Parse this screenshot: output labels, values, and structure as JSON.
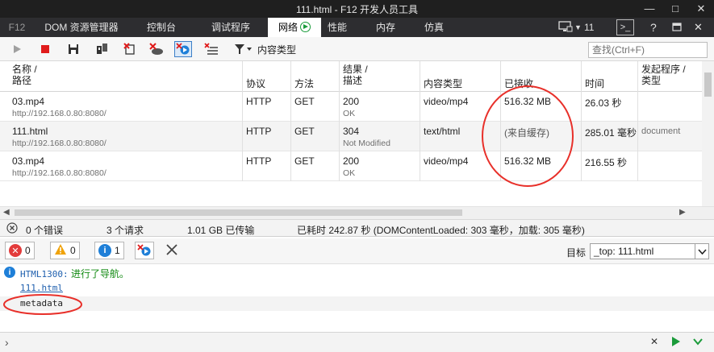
{
  "window": {
    "title": "111.html - F12 开发人员工具",
    "maximize_label": "□"
  },
  "tabs": [
    {
      "label": "F12"
    },
    {
      "label": "DOM 资源管理器"
    },
    {
      "label": "控制台"
    },
    {
      "label": "调试程序"
    },
    {
      "label": "网络"
    },
    {
      "label": "性能"
    },
    {
      "label": "内存"
    },
    {
      "label": "仿真"
    }
  ],
  "tab_right": {
    "count": "11"
  },
  "toolbar": {
    "filter_label": "内容类型",
    "search_placeholder": "查找(Ctrl+F)"
  },
  "grid": {
    "headers": {
      "name_line1": "名称 /",
      "name_line2": "路径",
      "protocol": "协议",
      "method": "方法",
      "result_line1": "结果 /",
      "result_line2": "描述",
      "type": "内容类型",
      "received": "已接收",
      "time": "时间",
      "initiator_line1": "发起程序 /",
      "initiator_line2": "类型"
    },
    "rows": [
      {
        "name": "03.mp4",
        "path": "http://192.168.0.80:8080/",
        "protocol": "HTTP",
        "method": "GET",
        "result": "200",
        "desc": "OK",
        "type": "video/mp4",
        "received": "516.32 MB",
        "time": "26.03 秒",
        "initiator": ""
      },
      {
        "name": "111.html",
        "path": "http://192.168.0.80:8080/",
        "protocol": "HTTP",
        "method": "GET",
        "result": "304",
        "desc": "Not Modified",
        "type": "text/html",
        "received": "(来自缓存)",
        "time": "285.01 毫秒",
        "initiator": "document"
      },
      {
        "name": "03.mp4",
        "path": "http://192.168.0.80:8080/",
        "protocol": "HTTP",
        "method": "GET",
        "result": "200",
        "desc": "OK",
        "type": "video/mp4",
        "received": "516.32 MB",
        "time": "216.55 秒",
        "initiator": ""
      }
    ]
  },
  "status": {
    "errors": "0 个错误",
    "requests": "3 个请求",
    "transferred": "1.01 GB 已传输",
    "elapsed": "已耗时 242.87 秒 (DOMContentLoaded: 303 毫秒，加载: 305 毫秒)"
  },
  "console_toolbar": {
    "errors": "0",
    "warnings": "0",
    "info": "1",
    "target_label": "目标",
    "target_value": "_top: 111.html"
  },
  "console": {
    "code": "HTML1300:",
    "message": "进行了导航。",
    "link": "111.html",
    "entry": "metadata"
  },
  "colors": {
    "title_bg": "#1f1f1f",
    "tab_bg": "#2d2d30",
    "annotation": "#e8302a",
    "error": "#e33b3b",
    "warning": "#f0a30a",
    "info": "#1e7fd8"
  }
}
